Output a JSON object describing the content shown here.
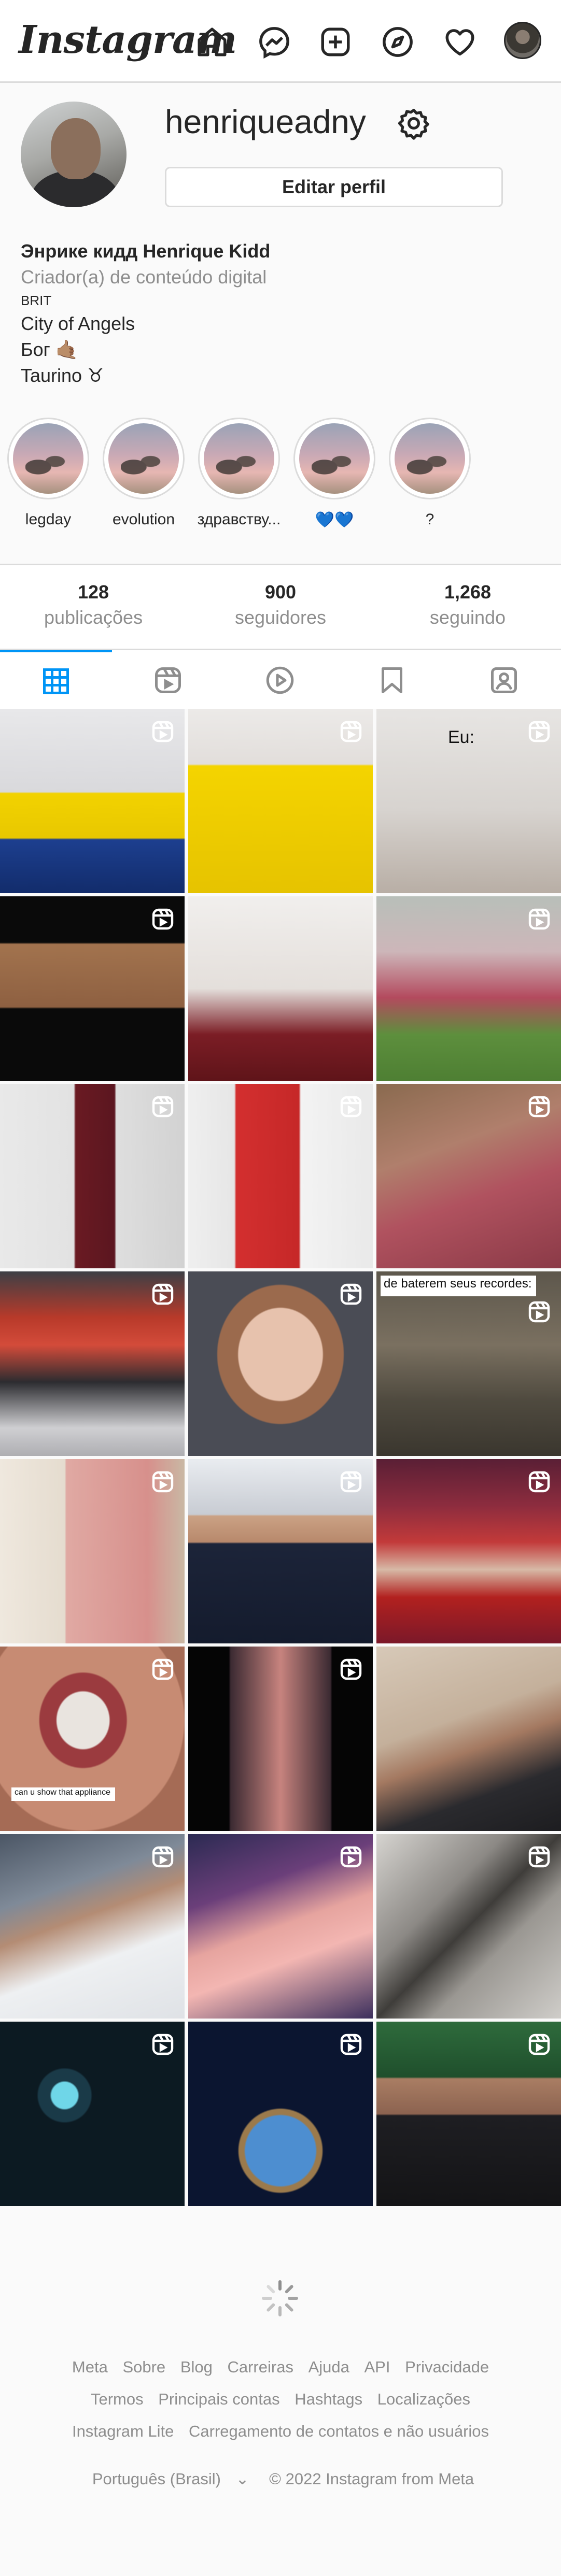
{
  "header": {
    "logo_text": "Instagram",
    "nav_icons": [
      "home-icon",
      "messenger-icon",
      "new-post-icon",
      "explore-icon",
      "activity-heart-icon",
      "profile-avatar"
    ]
  },
  "profile": {
    "username": "henriqueadny",
    "edit_button": "Editar perfil",
    "full_name": "Энрике кидд Henrique Kidd",
    "category": "Criador(a) de conteúdo digital",
    "bio_lines": [
      "BRIT",
      "City of Angels",
      "Бог 🤙🏽",
      "Taurino ♉"
    ]
  },
  "highlights": [
    {
      "label": "legday"
    },
    {
      "label": "evolution"
    },
    {
      "label": "здравству..."
    },
    {
      "label": "💙💙"
    },
    {
      "label": "?"
    }
  ],
  "stats": [
    {
      "value": "128",
      "label": "publicações"
    },
    {
      "value": "900",
      "label": "seguidores"
    },
    {
      "value": "1,268",
      "label": "seguindo"
    }
  ],
  "tabs": [
    {
      "icon": "grid-icon",
      "active": true
    },
    {
      "icon": "reels-icon",
      "active": false
    },
    {
      "icon": "video-play-icon",
      "active": false
    },
    {
      "icon": "bookmark-icon",
      "active": false
    },
    {
      "icon": "tagged-icon",
      "active": false
    }
  ],
  "grid_captions": {
    "post_3": "Eu:",
    "post_12": "de baterem seus recordes:",
    "post_16": "can u show that appliance"
  },
  "footer": {
    "row1": [
      "Meta",
      "Sobre",
      "Blog",
      "Carreiras",
      "Ajuda",
      "API",
      "Privacidade"
    ],
    "row2": [
      "Termos",
      "Principais contas",
      "Hashtags",
      "Localizações"
    ],
    "row3": [
      "Instagram Lite",
      "Carregamento de contatos e não usuários"
    ],
    "language": "Português (Brasil)",
    "copyright": "© 2022 Instagram from Meta"
  },
  "colors": {
    "accent": "#0095f6",
    "border": "#dbdbdb",
    "muted": "#8e8e8e",
    "text": "#262626"
  }
}
